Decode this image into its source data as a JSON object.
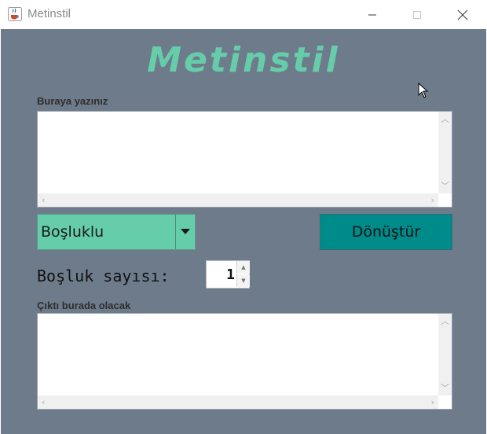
{
  "window": {
    "title": "Metinstil",
    "icon": "java-cup-icon"
  },
  "heading": "Metinstil",
  "input": {
    "label": "Buraya yazınız",
    "value": ""
  },
  "mode_select": {
    "selected": "Boşluklu"
  },
  "convert_button": "Dönüştür",
  "spacing": {
    "label": "Boşluk sayısı:",
    "value": "1"
  },
  "output": {
    "label": "Çıktı burada olacak",
    "value": ""
  },
  "colors": {
    "background": "#6e7b8b",
    "accent": "#66cdaa",
    "button": "#008b8b"
  }
}
